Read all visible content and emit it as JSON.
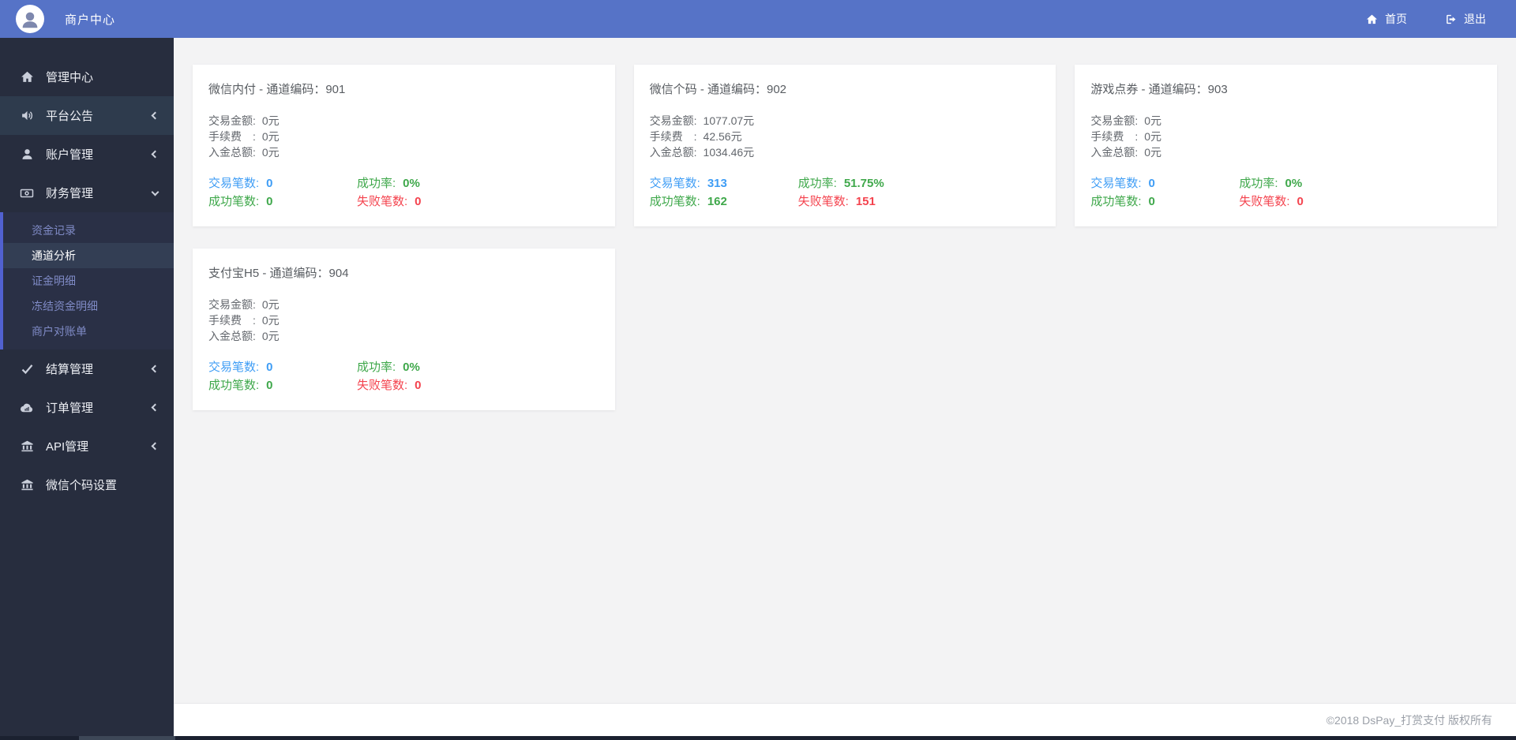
{
  "topbar": {
    "brand": "商户中心",
    "home_label": "首页",
    "logout_label": "退出"
  },
  "sidebar": {
    "items": [
      {
        "label": "管理中心",
        "icon": "home-icon"
      },
      {
        "label": "平台公告",
        "icon": "announcement-icon"
      },
      {
        "label": "账户管理",
        "icon": "user-icon"
      },
      {
        "label": "财务管理",
        "icon": "money-icon"
      },
      {
        "label": "结算管理",
        "icon": "check-icon"
      },
      {
        "label": "订单管理",
        "icon": "cloud-icon"
      },
      {
        "label": "API管理",
        "icon": "bank-icon"
      },
      {
        "label": "微信个码设置",
        "icon": "bank-icon"
      }
    ],
    "submenu": [
      {
        "label": "资金记录"
      },
      {
        "label": "通道分析",
        "active": true
      },
      {
        "label": "证金明细"
      },
      {
        "label": "冻结资金明细"
      },
      {
        "label": "商户对账单"
      }
    ]
  },
  "labels": {
    "trade_amount": "交易金额:",
    "fee": "手续费　:",
    "deposit": "入金总额:",
    "trade_count": "交易笔数:",
    "success_rate": "成功率:",
    "success_count": "成功笔数:",
    "fail_count": "失败笔数:"
  },
  "cards": [
    {
      "title": "微信内付 - 通道编码：901",
      "trade_amount": "0元",
      "fee": "0元",
      "deposit": "0元",
      "trade_count": "0",
      "success_rate": "0%",
      "success_count": "0",
      "fail_count": "0"
    },
    {
      "title": "微信个码 - 通道编码：902",
      "trade_amount": "1077.07元",
      "fee": "42.56元",
      "deposit": "1034.46元",
      "trade_count": "313",
      "success_rate": "51.75%",
      "success_count": "162",
      "fail_count": "151"
    },
    {
      "title": "游戏点券 - 通道编码：903",
      "trade_amount": "0元",
      "fee": "0元",
      "deposit": "0元",
      "trade_count": "0",
      "success_rate": "0%",
      "success_count": "0",
      "fail_count": "0"
    },
    {
      "title": "支付宝H5 - 通道编码：904",
      "trade_amount": "0元",
      "fee": "0元",
      "deposit": "0元",
      "trade_count": "0",
      "success_rate": "0%",
      "success_count": "0",
      "fail_count": "0"
    }
  ],
  "footer": {
    "copyright": "©2018 DsPay_打赏支付 版权所有"
  },
  "colors": {
    "topbar": "#5673c7",
    "sidebar": "#272d3e",
    "submenu_bg": "#2a3046",
    "submenu_border": "#5161d0",
    "count_blue": "#3f9df5",
    "success_green": "#3fa84b",
    "fail_red": "#f4434e"
  }
}
